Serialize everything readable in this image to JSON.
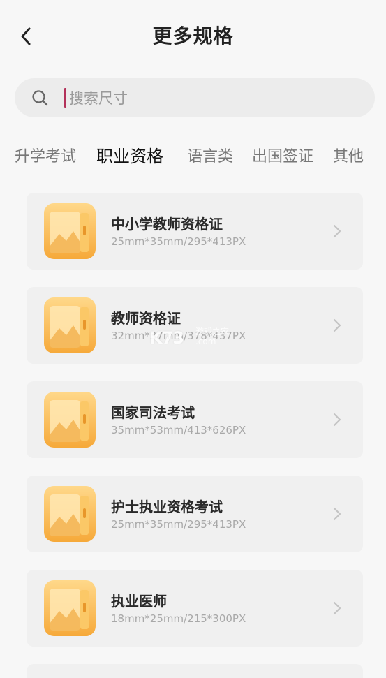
{
  "header": {
    "title": "更多规格"
  },
  "search": {
    "placeholder": "搜索尺寸"
  },
  "tabs": [
    {
      "label": "升学考试"
    },
    {
      "label": "职业资格"
    },
    {
      "label": "语言类"
    },
    {
      "label": "出国签证"
    },
    {
      "label": "其他"
    }
  ],
  "active_tab": "职业资格",
  "specs": [
    {
      "title": "中小学教师资格证",
      "size": "25mm*35mm/295*413PX"
    },
    {
      "title": "教师资格证",
      "size": "32mm*37mm/378*437PX"
    },
    {
      "title": "国家司法考试",
      "size": "35mm*53mm/413*626PX"
    },
    {
      "title": "护士执业资格考试",
      "size": "25mm*35mm/295*413PX"
    },
    {
      "title": "执业医师",
      "size": "18mm*25mm/215*300PX"
    }
  ],
  "watermark": {
    "logo": "K73",
    "text": "游戏之家",
    "domain": ".com"
  },
  "colors": {
    "accent": "#f7b84a",
    "caret": "#b3315a",
    "background": "#f7f7f7",
    "card": "#f0f0f0"
  }
}
